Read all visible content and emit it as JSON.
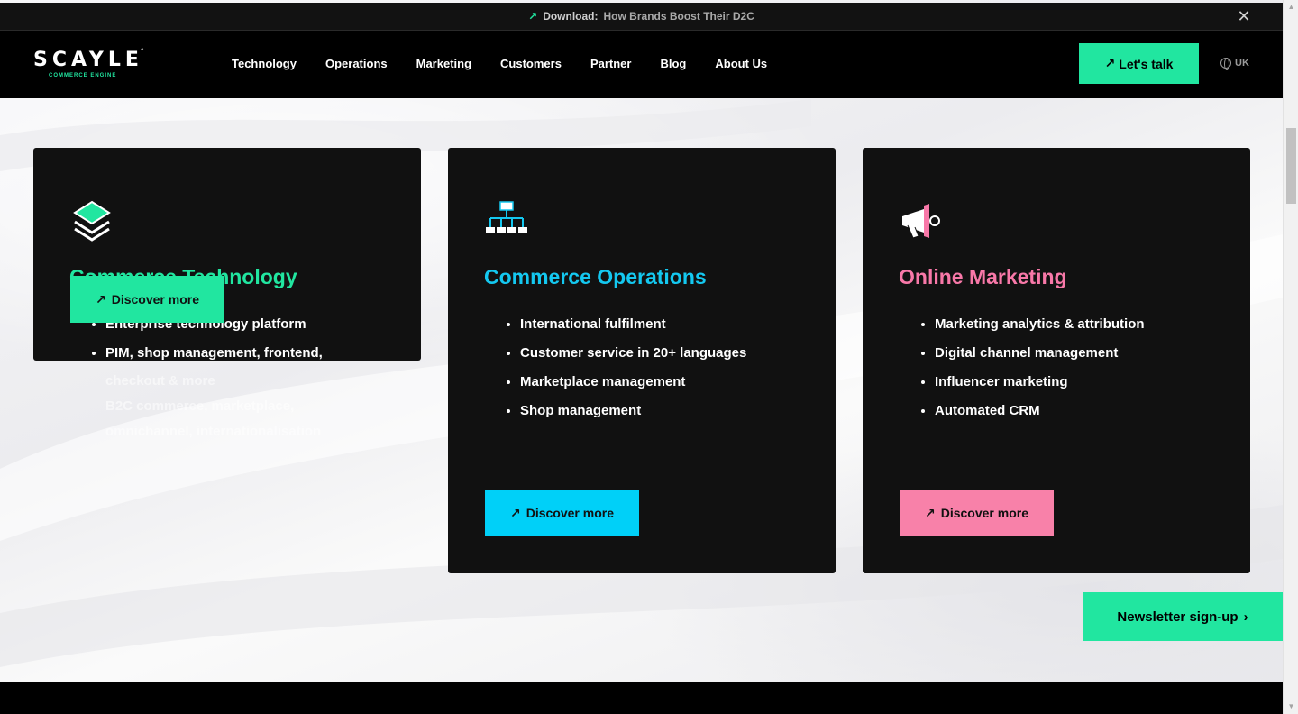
{
  "announcement": {
    "lead": "Download:",
    "link": "How Brands Boost Their D2C",
    "close_icon": "close-icon"
  },
  "logo": {
    "word": "SCAYLE",
    "sub": "COMMERCE ENGINE",
    "reg": "°"
  },
  "nav": {
    "items": [
      "Technology",
      "Operations",
      "Marketing",
      "Customers",
      "Partner",
      "Blog",
      "About Us"
    ],
    "cta": "Let's talk",
    "lang": "UK"
  },
  "cards": [
    {
      "title": "Commerce Technology",
      "icon": "layers-icon",
      "items": [
        "Enterprise technology platform",
        "PIM, shop management, frontend,"
      ],
      "overflow": [
        "checkout & more",
        "B2C commerce, marketplace,",
        "omnichannel, internationalisation"
      ],
      "button": "Discover more",
      "color": "#21e6a0"
    },
    {
      "title": "Commerce Operations",
      "icon": "org-chart-icon",
      "items": [
        "International fulfilment",
        "Customer service in 20+ languages",
        "Marketplace management",
        "Shop management"
      ],
      "button": "Discover more",
      "color": "#00d0f8"
    },
    {
      "title": "Online Marketing",
      "icon": "megaphone-icon",
      "items": [
        "Marketing analytics & attribution",
        "Digital channel management",
        "Influencer marketing",
        "Automated CRM"
      ],
      "button": "Discover more",
      "color": "#f881a9"
    }
  ],
  "newsletter": "Newsletter sign-up"
}
